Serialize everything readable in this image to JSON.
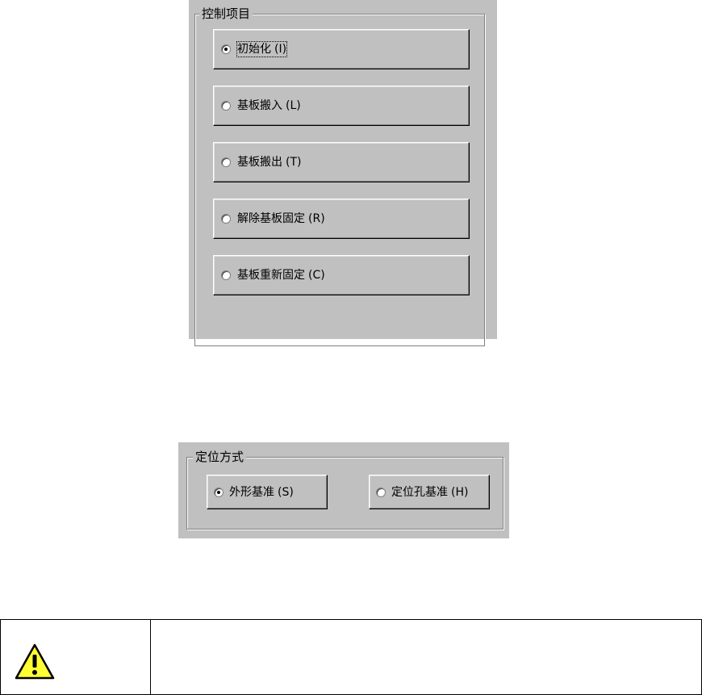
{
  "control_panel": {
    "legend": "控制项目",
    "options": [
      {
        "label": "初始化",
        "mnemonic": "(I)",
        "checked": true
      },
      {
        "label": "基板搬入",
        "mnemonic": "(L)",
        "checked": false
      },
      {
        "label": "基板搬出",
        "mnemonic": "(T)",
        "checked": false
      },
      {
        "label": "解除基板固定",
        "mnemonic": "(R)",
        "checked": false
      },
      {
        "label": "基板重新固定",
        "mnemonic": "(C)",
        "checked": false
      }
    ]
  },
  "positioning_panel": {
    "legend": "定位方式",
    "options": [
      {
        "label": "外形基准",
        "mnemonic": "(S)",
        "checked": true
      },
      {
        "label": "定位孔基准",
        "mnemonic": "(H)",
        "checked": false
      }
    ]
  },
  "warning_table": {
    "icon": "warning-triangle-icon",
    "text": ""
  }
}
